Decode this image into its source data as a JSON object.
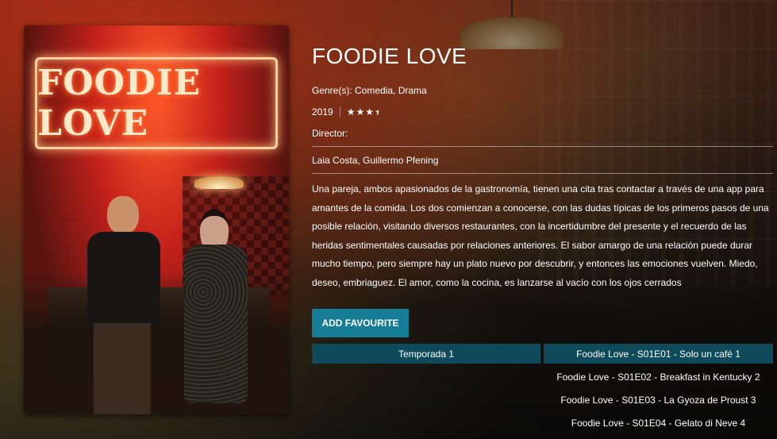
{
  "movie": {
    "title": "FOODIE LOVE",
    "poster_title": "FOODIE LOVE",
    "genres_label": "Genre(s): Comedia, Drama",
    "year": "2019",
    "rating": 3.5,
    "stars_text": "★★★",
    "director_label": "Director:",
    "cast": "Laia Costa, Guillermo Pfening",
    "synopsis": "Una pareja, ambos apasionados de la gastronomía, tienen una cita tras contactar a través de una app para amantes de la comida. Los dos comienzan a conocerse, con las dudas típicas de los primeros pasos de una posible relación, visitando diversos restaurantes, con la incertidumbre del presente y el recuerdo de las heridas sentimentales causadas por relaciones anteriores. El sabor amargo de una relación puede durar mucho tiempo, pero siempre hay un plato nuevo por descubrir, y entonces las emociones vuelven. Miedo, deseo, embriaguez. El amor, como la cocina, es lanzarse al vacío con los ojos cerrados"
  },
  "actions": {
    "add_favourite": "ADD FAVOURITE"
  },
  "seasons": [
    {
      "label": "Temporada 1"
    }
  ],
  "episodes": [
    {
      "label": "Foodie Love - S01E01 - Solo un café 1"
    },
    {
      "label": "Foodie Love - S01E02 - Breakfast in Kentucky 2"
    },
    {
      "label": "Foodie Love - S01E03 - La Gyoza de Proust 3"
    },
    {
      "label": "Foodie Love - S01E04 - Gelato di Neve 4"
    }
  ],
  "colors": {
    "accent": "#167d97",
    "tab_bg": "#0e4a5a"
  }
}
